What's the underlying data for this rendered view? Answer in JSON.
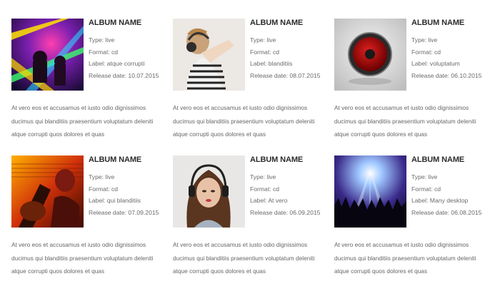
{
  "albums": [
    {
      "title": "ALBUM NAME",
      "type": "Type: live",
      "format": "Format: cd",
      "label": "Label: atque corrupti",
      "release": "Release date: 10.07.2015",
      "description": "At vero eos et accusamus et iusto odio dignissimos ducimus qui blanditiis praesentium voluptatum deleniti atque corrupti quos dolores et quas",
      "image": "concert-lights-image"
    },
    {
      "title": "ALBUM NAME",
      "type": "Type: live",
      "format": "Format: cd",
      "label": "Label: blanditiis",
      "release": "Release date: 08.07.2015",
      "description": "At vero eos et accusamus et iusto odio dignissimos ducimus qui blanditiis praesentium voluptatum deleniti atque corrupti quos dolores et quas",
      "image": "headphones-woman-image"
    },
    {
      "title": "ALBUM NAME",
      "type": "Type: live",
      "format": "Format: cd",
      "label": "Label: voluptatum",
      "release": "Release date: 06.10.2015",
      "description": "At vero eos et accusamus et iusto odio dignissimos ducimus qui blanditiis praesentium voluptatum deleniti atque corrupti quos dolores et quas",
      "image": "speaker-image"
    },
    {
      "title": "ALBUM NAME",
      "type": "Type: live",
      "format": "Format: cd",
      "label": "Label: qui blanditiis",
      "release": "Release date: 07.09.2015",
      "description": "At vero eos et accusamus et iusto odio dignissimos ducimus qui blanditiis praesentium voluptatum deleniti atque corrupti quos dolores et quas",
      "image": "guitar-collage-image"
    },
    {
      "title": "ALBUM NAME",
      "type": "Type: live",
      "format": "Format: cd",
      "label": "Label: At vero",
      "release": "Release date: 06.09.2015",
      "description": "At vero eos et accusamus et iusto odio dignissimos ducimus qui blanditiis praesentium voluptatum deleniti atque corrupti quos dolores et quas",
      "image": "girl-headphones-image"
    },
    {
      "title": "ALBUM NAME",
      "type": "Type: live",
      "format": "Format: cd",
      "label": "Label: Many desktop",
      "release": "Release date: 06.08.2015",
      "description": "At vero eos et accusamus et iusto odio dignissimos ducimus qui blanditiis praesentium voluptatum deleniti atque corrupti quos dolores et quas",
      "image": "crowd-stage-image"
    }
  ]
}
